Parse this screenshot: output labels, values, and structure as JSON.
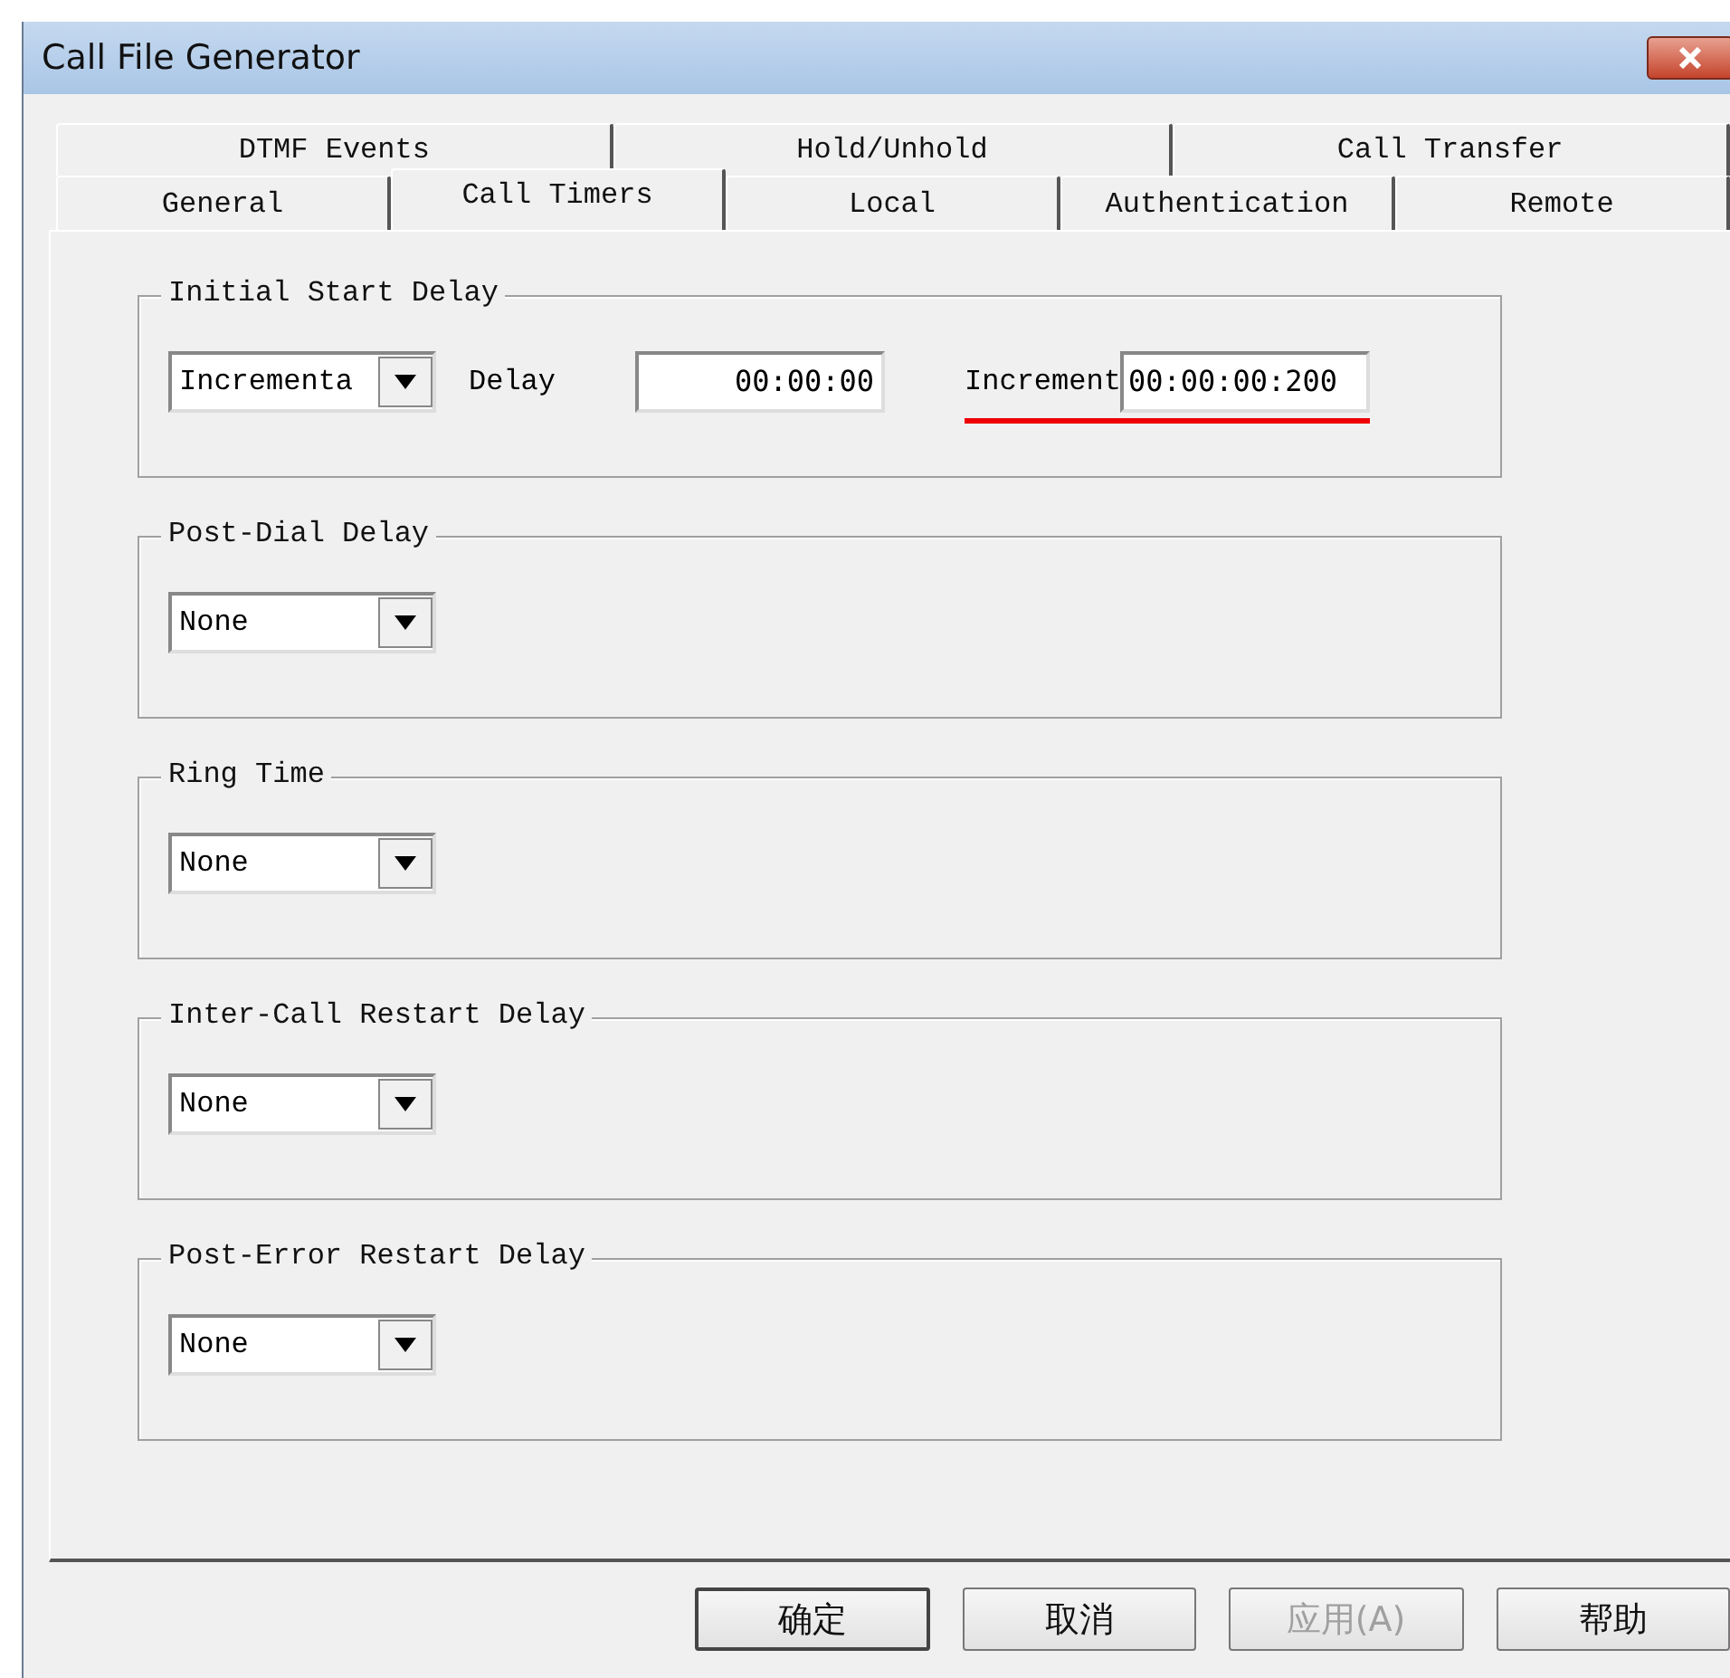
{
  "window": {
    "title": "Call File Generator"
  },
  "tab_rows": [
    {
      "tabs": [
        {
          "label": "DTMF Events",
          "selected": false
        },
        {
          "label": "Hold/Unhold",
          "selected": false
        },
        {
          "label": "Call Transfer",
          "selected": false
        }
      ]
    },
    {
      "tabs": [
        {
          "label": "General",
          "selected": false
        },
        {
          "label": "Call Timers",
          "selected": true
        },
        {
          "label": "Local",
          "selected": false
        },
        {
          "label": "Authentication",
          "selected": false
        },
        {
          "label": "Remote",
          "selected": false
        }
      ]
    }
  ],
  "groups": [
    {
      "title": "Initial Start Delay",
      "dropdown": "Incrementa",
      "delay": {
        "label": "Delay",
        "value": "00:00:00"
      },
      "increment": {
        "label": "Increment",
        "value": "00:00:00:200",
        "underlined": true
      }
    },
    {
      "title": "Post-Dial Delay",
      "dropdown": "None"
    },
    {
      "title": "Ring Time",
      "dropdown": "None"
    },
    {
      "title": "Inter-Call Restart Delay",
      "dropdown": "None"
    },
    {
      "title": "Post-Error Restart Delay",
      "dropdown": "None"
    }
  ],
  "buttons": [
    {
      "label": "确定",
      "disabled": false,
      "default": true
    },
    {
      "label": "取消",
      "disabled": false,
      "default": false
    },
    {
      "label": "应用(A)",
      "disabled": true,
      "default": false
    },
    {
      "label": "帮助",
      "disabled": false,
      "default": false
    }
  ]
}
